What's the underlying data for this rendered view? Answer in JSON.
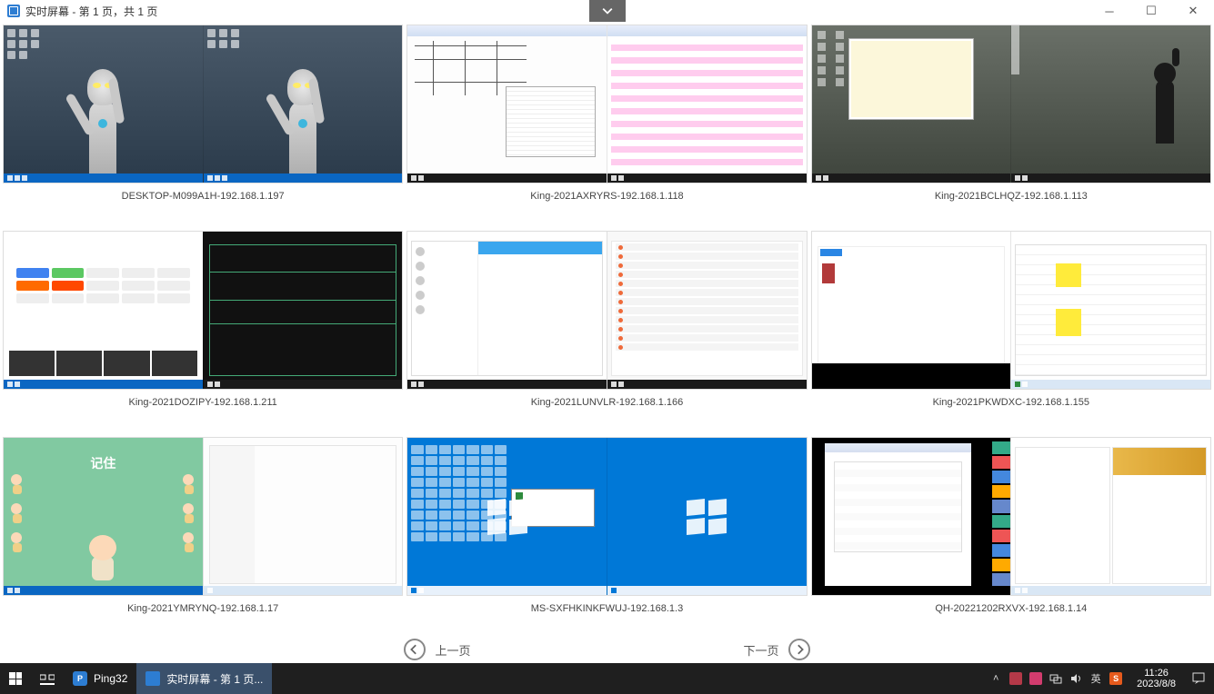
{
  "window": {
    "title": "实时屏幕 - 第 1 页，共 1 页",
    "dropdown_icon": "chevron-down"
  },
  "screens": [
    {
      "label": "DESKTOP-M099A1H-192.168.1.197"
    },
    {
      "label": "King-2021AXRYRS-192.168.1.118"
    },
    {
      "label": "King-2021BCLHQZ-192.168.1.113"
    },
    {
      "label": "King-2021DOZIPY-192.168.1.211"
    },
    {
      "label": "King-2021LUNVLR-192.168.1.166"
    },
    {
      "label": "King-2021PKWDXC-192.168.1.155"
    },
    {
      "label": "King-2021YMRYNQ-192.168.1.17"
    },
    {
      "label": "MS-SXFHKINKFWUJ-192.168.1.3"
    },
    {
      "label": "QH-20221202RXVX-192.168.1.14"
    }
  ],
  "pager": {
    "prev": "上一页",
    "next": "下一页"
  },
  "thumb7": {
    "title": "记住"
  },
  "taskbar": {
    "app1_name": "Ping32",
    "app2_name": "实时屏幕 - 第 1 页...",
    "ime": "英",
    "time": "11:26",
    "date": "2023/8/8"
  },
  "colors": {
    "accent": "#0a66c2",
    "taskbar": "#1f1f1f"
  }
}
